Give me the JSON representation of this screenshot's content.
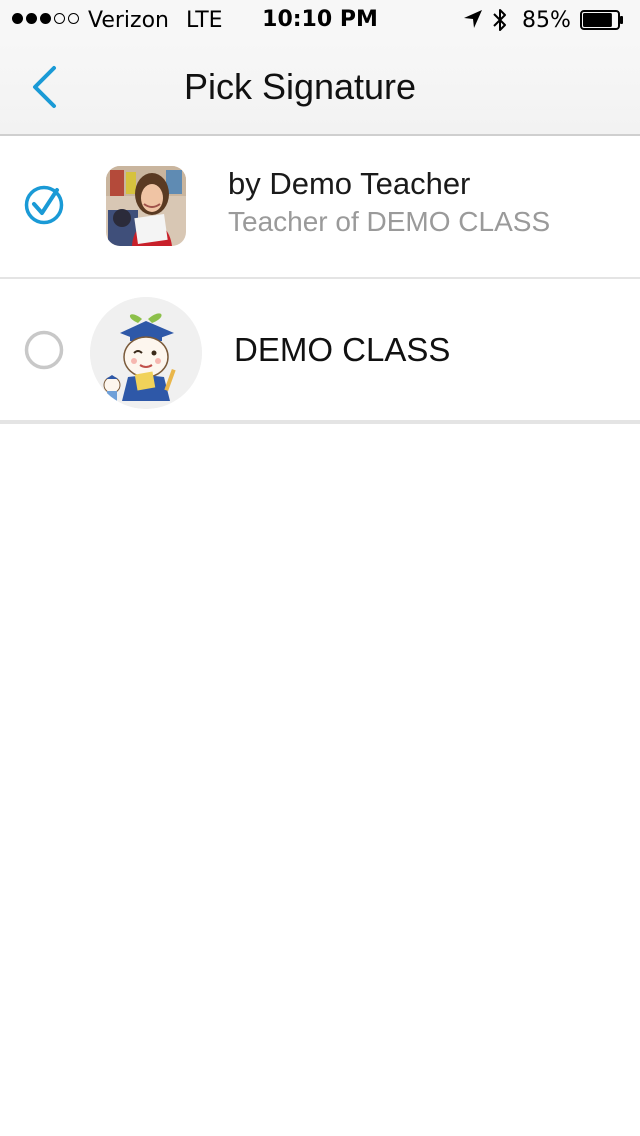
{
  "status_bar": {
    "signal_dots_filled": 3,
    "signal_dots_total": 5,
    "carrier": "Verizon",
    "network": "LTE",
    "time": "10:10 PM",
    "battery_percent": "85%",
    "battery_level": 0.85
  },
  "nav": {
    "title": "Pick Signature",
    "back_icon": "chevron-left-icon"
  },
  "signatures": [
    {
      "selected": true,
      "avatar": "teacher-photo",
      "primary": "by Demo Teacher",
      "secondary": "Teacher of DEMO CLASS"
    },
    {
      "selected": false,
      "avatar": "class-mascot",
      "primary": "DEMO CLASS"
    }
  ],
  "colors": {
    "accent": "#1a9ad6",
    "radio_unselected": "#c8c8c8",
    "secondary_text": "#9a9a9a",
    "separator": "#e4e4e4"
  }
}
